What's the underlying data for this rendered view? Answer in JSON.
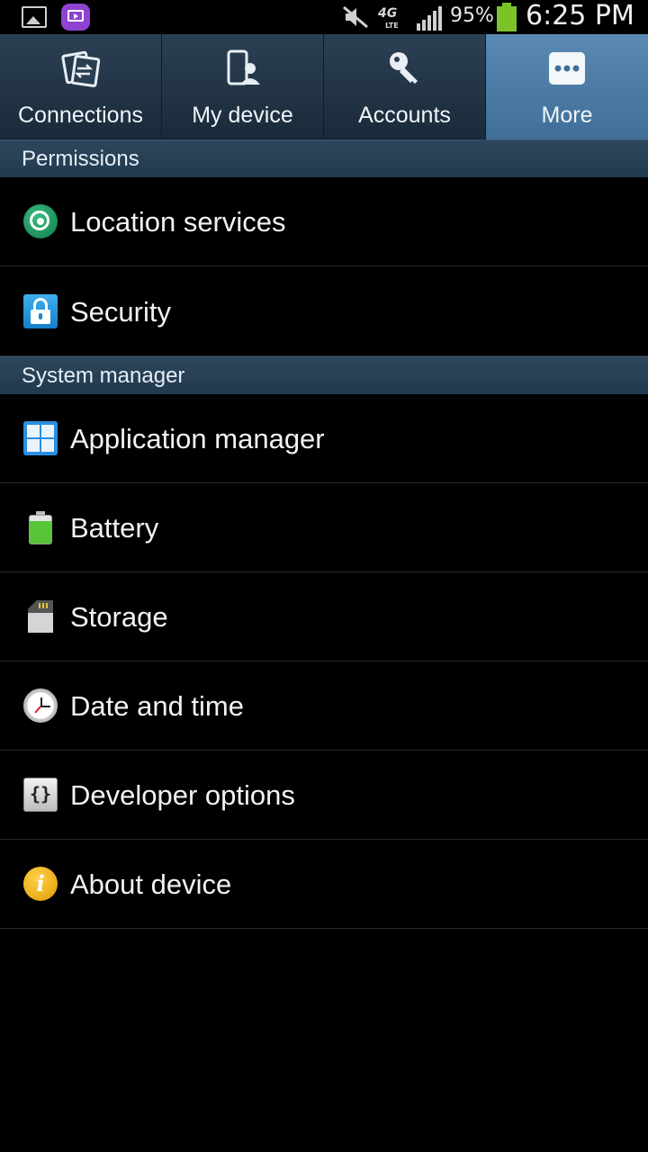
{
  "status_bar": {
    "battery_percent": "95%",
    "time": "6:25 PM",
    "network": "4G",
    "network_sub": "LTE",
    "icons": [
      "gallery-icon",
      "media-app-icon",
      "mute-icon",
      "network-4g-lte-icon",
      "signal-icon",
      "battery-icon"
    ]
  },
  "tabs": [
    {
      "label": "Connections",
      "icon": "connections-icon",
      "active": false
    },
    {
      "label": "My device",
      "icon": "my-device-icon",
      "active": false
    },
    {
      "label": "Accounts",
      "icon": "accounts-key-icon",
      "active": false
    },
    {
      "label": "More",
      "icon": "more-dots-icon",
      "active": true
    }
  ],
  "sections": [
    {
      "title": "Permissions",
      "items": [
        {
          "label": "Location services",
          "icon": "location-icon"
        },
        {
          "label": "Security",
          "icon": "lock-icon"
        }
      ]
    },
    {
      "title": "System manager",
      "items": [
        {
          "label": "Application manager",
          "icon": "app-grid-icon"
        },
        {
          "label": "Battery",
          "icon": "battery-icon"
        },
        {
          "label": "Storage",
          "icon": "sd-card-icon"
        },
        {
          "label": "Date and time",
          "icon": "clock-icon"
        },
        {
          "label": "Developer options",
          "icon": "braces-icon"
        },
        {
          "label": "About device",
          "icon": "info-icon"
        }
      ]
    }
  ],
  "colors": {
    "active_tab": "#4a7ca6",
    "section_header": "#2a4258",
    "background": "#000000"
  }
}
